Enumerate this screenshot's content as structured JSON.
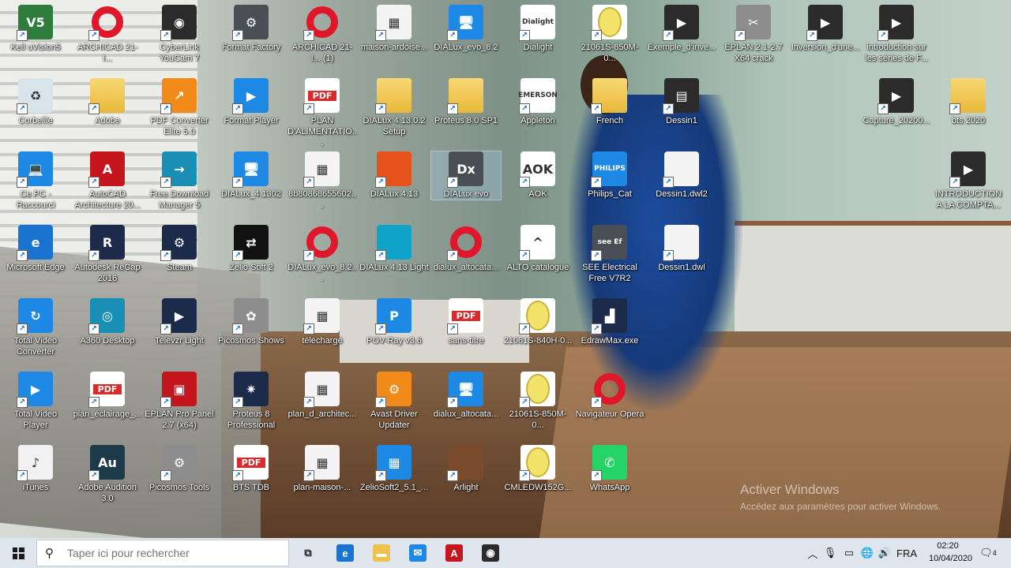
{
  "desktop": {
    "icons": [
      {
        "label": "Keil uVision5",
        "glyph": "V5",
        "kind": "green",
        "col": 0,
        "row": 0
      },
      {
        "label": "ARCHICAD 21-I...",
        "glyph": "",
        "kind": "opera",
        "col": 1,
        "row": 0
      },
      {
        "label": "CyberLink YouCam 7",
        "glyph": "◉",
        "kind": "dark",
        "col": 2,
        "row": 0
      },
      {
        "label": "Format Factory",
        "glyph": "⚙",
        "kind": "gray",
        "col": 3,
        "row": 0
      },
      {
        "label": "ARCHICAD 21-I... (1)",
        "glyph": "",
        "kind": "opera",
        "col": 4,
        "row": 0
      },
      {
        "label": "maison-ardoise...",
        "glyph": "▦",
        "kind": "doc",
        "col": 5,
        "row": 0
      },
      {
        "label": "DIALux_evo_8.2",
        "glyph": "🖥",
        "kind": "blue",
        "col": 6,
        "row": 0
      },
      {
        "label": "Dialight",
        "glyph": "Dialight",
        "kind": "white",
        "col": 7,
        "row": 0
      },
      {
        "label": "21061S-850M-0...",
        "glyph": "",
        "kind": "egg",
        "col": 8,
        "row": 0
      },
      {
        "label": "Exemple_d'inve...",
        "glyph": "▶",
        "kind": "dark",
        "col": 9,
        "row": 0
      },
      {
        "label": "EPLAN 2.1-2.7 X64 crack",
        "glyph": "✂",
        "kind": "tool",
        "col": 10,
        "row": 0
      },
      {
        "label": "Inversion_d'une...",
        "glyph": "▶",
        "kind": "dark",
        "col": 11,
        "row": 0
      },
      {
        "label": "introduction sur les séries de F...",
        "glyph": "▶",
        "kind": "dark",
        "col": 12,
        "row": 0
      },
      {
        "label": "Corbeille",
        "glyph": "♻",
        "kind": "bin",
        "col": 0,
        "row": 1
      },
      {
        "label": "Adobe",
        "glyph": "",
        "kind": "folder",
        "col": 1,
        "row": 1
      },
      {
        "label": "PDF Converter Elite 5.0",
        "glyph": "↗",
        "kind": "orange",
        "col": 2,
        "row": 1
      },
      {
        "label": "Format Player",
        "glyph": "▶",
        "kind": "blue",
        "col": 3,
        "row": 1
      },
      {
        "label": "PLAN D'ALIMENTATIO...",
        "glyph": "",
        "kind": "pdf",
        "col": 4,
        "row": 1
      },
      {
        "label": "DIALux 4.13.0.2 Setup",
        "glyph": "",
        "kind": "folder",
        "col": 5,
        "row": 1
      },
      {
        "label": "Proteus 8.0 SP1",
        "glyph": "",
        "kind": "folder",
        "col": 6,
        "row": 1
      },
      {
        "label": "Appleton",
        "glyph": "EMERSON",
        "kind": "white",
        "col": 7,
        "row": 1
      },
      {
        "label": "French",
        "glyph": "",
        "kind": "folder",
        "col": 8,
        "row": 1
      },
      {
        "label": "Dessin1",
        "glyph": "▤",
        "kind": "dark",
        "col": 9,
        "row": 1
      },
      {
        "label": "Capture_20200...",
        "glyph": "▶",
        "kind": "dark",
        "col": 12,
        "row": 1
      },
      {
        "label": "bts 2020",
        "glyph": "",
        "kind": "folder",
        "col": 13,
        "row": 1
      },
      {
        "label": "Ce PC - Raccourci",
        "glyph": "💻",
        "kind": "blue",
        "col": 0,
        "row": 2
      },
      {
        "label": "AutoCAD Architecture 20...",
        "glyph": "A",
        "kind": "red",
        "col": 1,
        "row": 2
      },
      {
        "label": "Free Download Manager 5",
        "glyph": "→",
        "kind": "teal",
        "col": 2,
        "row": 2
      },
      {
        "label": "DIALux_4.1302",
        "glyph": "🖥",
        "kind": "blue",
        "col": 3,
        "row": 2
      },
      {
        "label": "8b80868655602...",
        "glyph": "▦",
        "kind": "doc",
        "col": 4,
        "row": 2
      },
      {
        "label": "DIALux 4.13",
        "glyph": "",
        "kind": "orangered",
        "col": 5,
        "row": 2
      },
      {
        "label": "DIALux evo",
        "glyph": "Dx",
        "kind": "gray",
        "col": 6,
        "row": 2,
        "sel": true
      },
      {
        "label": "AOK",
        "glyph": "AOK",
        "kind": "white",
        "col": 7,
        "row": 2
      },
      {
        "label": "Philips_Cat",
        "glyph": "PHILIPS",
        "kind": "blue",
        "col": 8,
        "row": 2
      },
      {
        "label": "Dessin1.dwl2",
        "glyph": "",
        "kind": "doc",
        "col": 9,
        "row": 2
      },
      {
        "label": "INTRODUCTION A LA COMPTA...",
        "glyph": "▶",
        "kind": "dark",
        "col": 13,
        "row": 2
      },
      {
        "label": "Microsoft Edge",
        "glyph": "e",
        "kind": "edge",
        "col": 0,
        "row": 3
      },
      {
        "label": "Autodesk ReCap 2016",
        "glyph": "R",
        "kind": "navy",
        "col": 1,
        "row": 3
      },
      {
        "label": "Steam",
        "glyph": "⚙",
        "kind": "navy",
        "col": 2,
        "row": 3
      },
      {
        "label": "Zelio Soft 2",
        "glyph": "⇄",
        "kind": "black",
        "col": 3,
        "row": 3
      },
      {
        "label": "DIALux_evo_8.2...",
        "glyph": "",
        "kind": "opera",
        "col": 4,
        "row": 3
      },
      {
        "label": "DIALux 4.13 Light",
        "glyph": "",
        "kind": "cyan",
        "col": 5,
        "row": 3
      },
      {
        "label": "dialux_altocata...",
        "glyph": "",
        "kind": "opera",
        "col": 6,
        "row": 3
      },
      {
        "label": "ALTO catalogue",
        "glyph": "^",
        "kind": "white",
        "col": 7,
        "row": 3
      },
      {
        "label": "SEE Electrical Free V7R2",
        "glyph": "see Ef",
        "kind": "gray",
        "col": 8,
        "row": 3
      },
      {
        "label": "Dessin1.dwl",
        "glyph": "",
        "kind": "doc",
        "col": 9,
        "row": 3
      },
      {
        "label": "Total Video Converter",
        "glyph": "↻",
        "kind": "blue",
        "col": 0,
        "row": 4
      },
      {
        "label": "A360 Desktop",
        "glyph": "◎",
        "kind": "teal",
        "col": 1,
        "row": 4
      },
      {
        "label": "Televzr Light",
        "glyph": "▶",
        "kind": "navy",
        "col": 2,
        "row": 4
      },
      {
        "label": "Picosmos Shows",
        "glyph": "✿",
        "kind": "tool",
        "col": 3,
        "row": 4
      },
      {
        "label": "téléchargé",
        "glyph": "▦",
        "kind": "doc",
        "col": 4,
        "row": 4
      },
      {
        "label": "POV-Ray v3.6",
        "glyph": "P",
        "kind": "blue",
        "col": 5,
        "row": 4
      },
      {
        "label": "sans-titre",
        "glyph": "",
        "kind": "pdf",
        "col": 6,
        "row": 4
      },
      {
        "label": "21061S-840H-0...",
        "glyph": "",
        "kind": "egg",
        "col": 7,
        "row": 4
      },
      {
        "label": "EdrawMax.exe",
        "glyph": "▟",
        "kind": "navy",
        "col": 8,
        "row": 4
      },
      {
        "label": "Total Video Player",
        "glyph": "▶",
        "kind": "blue",
        "col": 0,
        "row": 5
      },
      {
        "label": "plan_éclairage_...",
        "glyph": "",
        "kind": "pdf",
        "col": 1,
        "row": 5
      },
      {
        "label": "EPLAN Pro Panel 2.7 (x64)",
        "glyph": "▣",
        "kind": "red",
        "col": 2,
        "row": 5
      },
      {
        "label": "Proteus 8 Professional",
        "glyph": "✷",
        "kind": "navy",
        "col": 3,
        "row": 5
      },
      {
        "label": "plan_d_architec...",
        "glyph": "▦",
        "kind": "doc",
        "col": 4,
        "row": 5
      },
      {
        "label": "Avast Driver Updater",
        "glyph": "⚙",
        "kind": "orange",
        "col": 5,
        "row": 5
      },
      {
        "label": "dialux_altocata...",
        "glyph": "🖥",
        "kind": "blue",
        "col": 6,
        "row": 5
      },
      {
        "label": "21061S-850M-0...",
        "glyph": "",
        "kind": "egg",
        "col": 7,
        "row": 5
      },
      {
        "label": "Navigateur Opera",
        "glyph": "",
        "kind": "opera",
        "col": 8,
        "row": 5
      },
      {
        "label": "iTunes",
        "glyph": "♪",
        "kind": "itunes",
        "col": 0,
        "row": 6
      },
      {
        "label": "Adobe Audition 3.0",
        "glyph": "Au",
        "kind": "au",
        "col": 1,
        "row": 6
      },
      {
        "label": "Picosmos Tools",
        "glyph": "⚙",
        "kind": "tool",
        "col": 2,
        "row": 6
      },
      {
        "label": "BTS TDB",
        "glyph": "",
        "kind": "pdf",
        "col": 3,
        "row": 6
      },
      {
        "label": "plan-maison-...",
        "glyph": "▦",
        "kind": "doc",
        "col": 4,
        "row": 6
      },
      {
        "label": "ZelioSoft2_5.1_...",
        "glyph": "▦",
        "kind": "blue",
        "col": 5,
        "row": 6
      },
      {
        "label": "Arlight",
        "glyph": "",
        "kind": "brown",
        "col": 6,
        "row": 6
      },
      {
        "label": "CMLEDW152G...",
        "glyph": "",
        "kind": "egg",
        "col": 7,
        "row": 6
      },
      {
        "label": "WhatsApp",
        "glyph": "✆",
        "kind": "whatsapp",
        "col": 8,
        "row": 6
      }
    ],
    "watermark": {
      "title": "Activer Windows",
      "subtitle": "Accédez aux paramètres pour activer Windows."
    }
  },
  "colors": {
    "green": "#2f7d3c",
    "opera": "#e0162b",
    "dark": "#2b2b2b",
    "gray": "#4a4f55",
    "doc": "#f4f4f4",
    "blue": "#1e88e5",
    "white": "#ffffff",
    "tool": "#8d8d8d",
    "bin": "#d9e3ea",
    "folder": "#f0c24d",
    "orange": "#f28a1a",
    "red": "#c4161c",
    "teal": "#1a8fb5",
    "orangered": "#e5531a",
    "edge": "#1a73d1",
    "navy": "#1d2b4a",
    "black": "#111111",
    "cyan": "#0fa3c9",
    "itunes": "#f1f1f1",
    "au": "#1d3a4a",
    "brown": "#7a4a2c",
    "whatsapp": "#25d366",
    "pdf": "#ffffff",
    "egg": "#ffffff"
  },
  "taskbar": {
    "search_placeholder": "Taper ici pour rechercher",
    "apps": [
      {
        "name": "task-view",
        "glyph": "⧉",
        "color": "transparent"
      },
      {
        "name": "edge",
        "glyph": "e",
        "color": "#1a73d1"
      },
      {
        "name": "file-explorer",
        "glyph": "▬",
        "color": "#f0c24d"
      },
      {
        "name": "mail",
        "glyph": "✉",
        "color": "#1e88e5"
      },
      {
        "name": "autocad",
        "glyph": "A",
        "color": "#c4161c"
      },
      {
        "name": "youcam",
        "glyph": "◉",
        "color": "#2b2b2b"
      }
    ],
    "language": "FRA",
    "time": "02:20",
    "date": "10/04/2020",
    "notification_count": "4"
  }
}
